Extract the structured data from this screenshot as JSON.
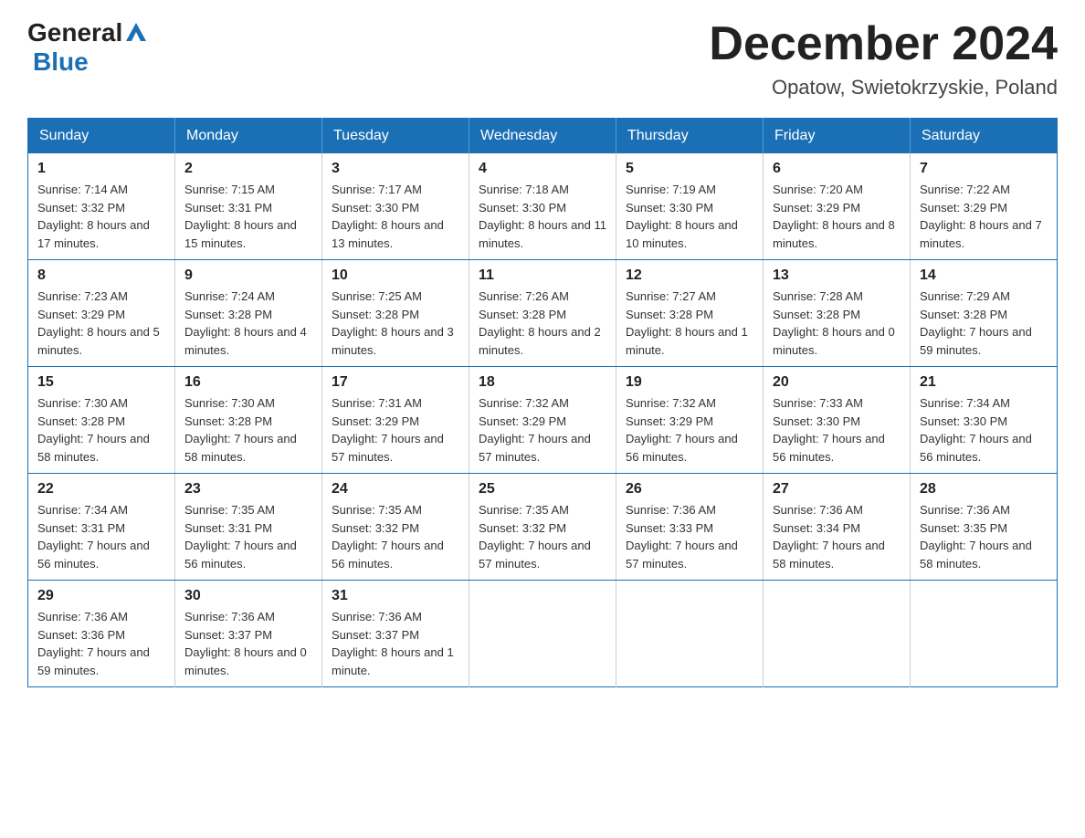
{
  "header": {
    "logo": {
      "general": "General",
      "blue": "Blue",
      "aria": "GeneralBlue logo"
    },
    "title": "December 2024",
    "subtitle": "Opatow, Swietokrzyskie, Poland"
  },
  "calendar": {
    "days_of_week": [
      "Sunday",
      "Monday",
      "Tuesday",
      "Wednesday",
      "Thursday",
      "Friday",
      "Saturday"
    ],
    "weeks": [
      [
        {
          "date": "1",
          "sunrise": "Sunrise: 7:14 AM",
          "sunset": "Sunset: 3:32 PM",
          "daylight": "Daylight: 8 hours and 17 minutes."
        },
        {
          "date": "2",
          "sunrise": "Sunrise: 7:15 AM",
          "sunset": "Sunset: 3:31 PM",
          "daylight": "Daylight: 8 hours and 15 minutes."
        },
        {
          "date": "3",
          "sunrise": "Sunrise: 7:17 AM",
          "sunset": "Sunset: 3:30 PM",
          "daylight": "Daylight: 8 hours and 13 minutes."
        },
        {
          "date": "4",
          "sunrise": "Sunrise: 7:18 AM",
          "sunset": "Sunset: 3:30 PM",
          "daylight": "Daylight: 8 hours and 11 minutes."
        },
        {
          "date": "5",
          "sunrise": "Sunrise: 7:19 AM",
          "sunset": "Sunset: 3:30 PM",
          "daylight": "Daylight: 8 hours and 10 minutes."
        },
        {
          "date": "6",
          "sunrise": "Sunrise: 7:20 AM",
          "sunset": "Sunset: 3:29 PM",
          "daylight": "Daylight: 8 hours and 8 minutes."
        },
        {
          "date": "7",
          "sunrise": "Sunrise: 7:22 AM",
          "sunset": "Sunset: 3:29 PM",
          "daylight": "Daylight: 8 hours and 7 minutes."
        }
      ],
      [
        {
          "date": "8",
          "sunrise": "Sunrise: 7:23 AM",
          "sunset": "Sunset: 3:29 PM",
          "daylight": "Daylight: 8 hours and 5 minutes."
        },
        {
          "date": "9",
          "sunrise": "Sunrise: 7:24 AM",
          "sunset": "Sunset: 3:28 PM",
          "daylight": "Daylight: 8 hours and 4 minutes."
        },
        {
          "date": "10",
          "sunrise": "Sunrise: 7:25 AM",
          "sunset": "Sunset: 3:28 PM",
          "daylight": "Daylight: 8 hours and 3 minutes."
        },
        {
          "date": "11",
          "sunrise": "Sunrise: 7:26 AM",
          "sunset": "Sunset: 3:28 PM",
          "daylight": "Daylight: 8 hours and 2 minutes."
        },
        {
          "date": "12",
          "sunrise": "Sunrise: 7:27 AM",
          "sunset": "Sunset: 3:28 PM",
          "daylight": "Daylight: 8 hours and 1 minute."
        },
        {
          "date": "13",
          "sunrise": "Sunrise: 7:28 AM",
          "sunset": "Sunset: 3:28 PM",
          "daylight": "Daylight: 8 hours and 0 minutes."
        },
        {
          "date": "14",
          "sunrise": "Sunrise: 7:29 AM",
          "sunset": "Sunset: 3:28 PM",
          "daylight": "Daylight: 7 hours and 59 minutes."
        }
      ],
      [
        {
          "date": "15",
          "sunrise": "Sunrise: 7:30 AM",
          "sunset": "Sunset: 3:28 PM",
          "daylight": "Daylight: 7 hours and 58 minutes."
        },
        {
          "date": "16",
          "sunrise": "Sunrise: 7:30 AM",
          "sunset": "Sunset: 3:28 PM",
          "daylight": "Daylight: 7 hours and 58 minutes."
        },
        {
          "date": "17",
          "sunrise": "Sunrise: 7:31 AM",
          "sunset": "Sunset: 3:29 PM",
          "daylight": "Daylight: 7 hours and 57 minutes."
        },
        {
          "date": "18",
          "sunrise": "Sunrise: 7:32 AM",
          "sunset": "Sunset: 3:29 PM",
          "daylight": "Daylight: 7 hours and 57 minutes."
        },
        {
          "date": "19",
          "sunrise": "Sunrise: 7:32 AM",
          "sunset": "Sunset: 3:29 PM",
          "daylight": "Daylight: 7 hours and 56 minutes."
        },
        {
          "date": "20",
          "sunrise": "Sunrise: 7:33 AM",
          "sunset": "Sunset: 3:30 PM",
          "daylight": "Daylight: 7 hours and 56 minutes."
        },
        {
          "date": "21",
          "sunrise": "Sunrise: 7:34 AM",
          "sunset": "Sunset: 3:30 PM",
          "daylight": "Daylight: 7 hours and 56 minutes."
        }
      ],
      [
        {
          "date": "22",
          "sunrise": "Sunrise: 7:34 AM",
          "sunset": "Sunset: 3:31 PM",
          "daylight": "Daylight: 7 hours and 56 minutes."
        },
        {
          "date": "23",
          "sunrise": "Sunrise: 7:35 AM",
          "sunset": "Sunset: 3:31 PM",
          "daylight": "Daylight: 7 hours and 56 minutes."
        },
        {
          "date": "24",
          "sunrise": "Sunrise: 7:35 AM",
          "sunset": "Sunset: 3:32 PM",
          "daylight": "Daylight: 7 hours and 56 minutes."
        },
        {
          "date": "25",
          "sunrise": "Sunrise: 7:35 AM",
          "sunset": "Sunset: 3:32 PM",
          "daylight": "Daylight: 7 hours and 57 minutes."
        },
        {
          "date": "26",
          "sunrise": "Sunrise: 7:36 AM",
          "sunset": "Sunset: 3:33 PM",
          "daylight": "Daylight: 7 hours and 57 minutes."
        },
        {
          "date": "27",
          "sunrise": "Sunrise: 7:36 AM",
          "sunset": "Sunset: 3:34 PM",
          "daylight": "Daylight: 7 hours and 58 minutes."
        },
        {
          "date": "28",
          "sunrise": "Sunrise: 7:36 AM",
          "sunset": "Sunset: 3:35 PM",
          "daylight": "Daylight: 7 hours and 58 minutes."
        }
      ],
      [
        {
          "date": "29",
          "sunrise": "Sunrise: 7:36 AM",
          "sunset": "Sunset: 3:36 PM",
          "daylight": "Daylight: 7 hours and 59 minutes."
        },
        {
          "date": "30",
          "sunrise": "Sunrise: 7:36 AM",
          "sunset": "Sunset: 3:37 PM",
          "daylight": "Daylight: 8 hours and 0 minutes."
        },
        {
          "date": "31",
          "sunrise": "Sunrise: 7:36 AM",
          "sunset": "Sunset: 3:37 PM",
          "daylight": "Daylight: 8 hours and 1 minute."
        },
        null,
        null,
        null,
        null
      ]
    ]
  }
}
